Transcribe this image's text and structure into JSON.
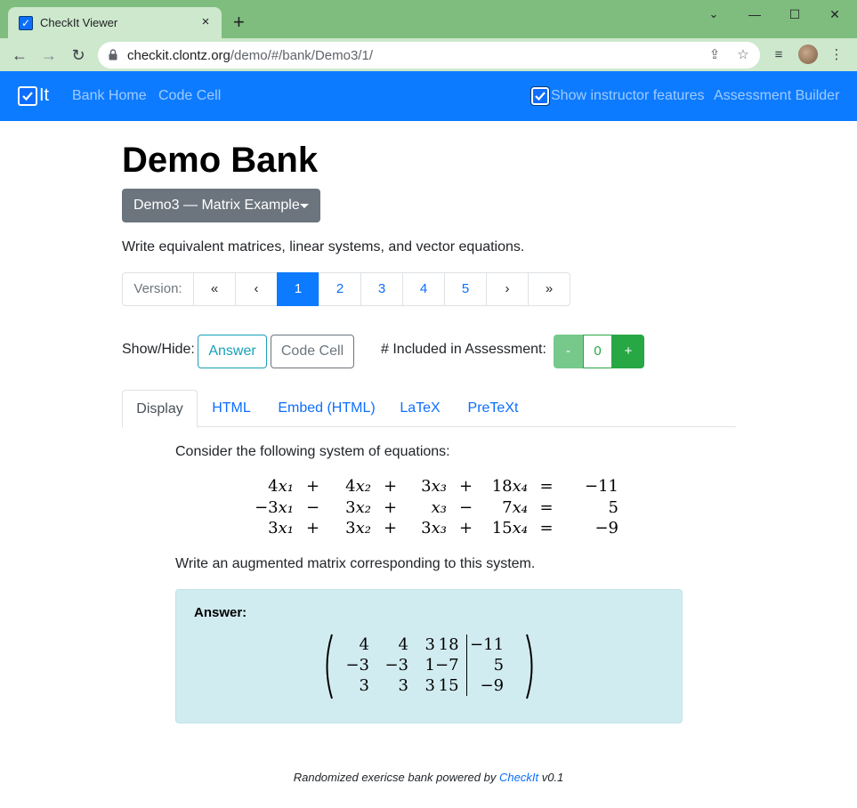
{
  "browser": {
    "tab_title": "CheckIt Viewer",
    "tab_close": "×",
    "new_tab": "+",
    "url_host": "checkit.clontz.org",
    "url_path": "/demo/#/bank/Demo3/1/",
    "window_minimize": "—",
    "window_maximize": "☐",
    "window_close": "✕"
  },
  "navbar": {
    "brand": "It",
    "links": [
      "Bank Home",
      "Code Cell"
    ],
    "instructor_label": "Show instructor features",
    "instructor_checked": true,
    "assessment_builder": "Assessment Builder"
  },
  "page": {
    "title": "Demo Bank",
    "exercise_dropdown": "Demo3 — Matrix Example",
    "description": "Write equivalent matrices, linear systems, and vector equations."
  },
  "pagination": {
    "label": "Version:",
    "first": "«",
    "prev": "‹",
    "versions": [
      "1",
      "2",
      "3",
      "4",
      "5"
    ],
    "active": "1",
    "next": "›",
    "last": "»"
  },
  "controls": {
    "show_hide_label": "Show/Hide:",
    "answer_button": "Answer",
    "code_cell_button": "Code Cell",
    "included_label": "# Included in Assessment:",
    "minus": "-",
    "count": "0",
    "plus": "+"
  },
  "tabs": [
    "Display",
    "HTML",
    "Embed (HTML)",
    "LaTeX",
    "PreTeXt"
  ],
  "active_tab": "Display",
  "exercise": {
    "prompt": "Consider the following system of equations:",
    "system": [
      {
        "t1": "4",
        "op1": "+",
        "t2": "4",
        "op2": "+",
        "t3": "3",
        "op3": "+",
        "t4": "18",
        "rhs": "−11"
      },
      {
        "t1": "−3",
        "op1": "−",
        "t2": "3",
        "op2": "+",
        "t3": "",
        "op3": "−",
        "t4": "7",
        "rhs": "5"
      },
      {
        "t1": "3",
        "op1": "+",
        "t2": "3",
        "op2": "+",
        "t3": "3",
        "op3": "+",
        "t4": "15",
        "rhs": "−9"
      }
    ],
    "instruction": "Write an augmented matrix corresponding to this system.",
    "answer_label": "Answer:",
    "matrix": [
      [
        "4",
        "4",
        "3",
        "18",
        "−11"
      ],
      [
        "−3",
        "−3",
        "1",
        "−7",
        "5"
      ],
      [
        "3",
        "3",
        "3",
        "15",
        "−9"
      ]
    ]
  },
  "footer": {
    "text": "Randomized exericse bank powered by",
    "link": "CheckIt",
    "version": "v0.1"
  },
  "colors": {
    "primary": "#0d7bff",
    "info": "#17a2b8",
    "success": "#28a745",
    "secondary": "#6c757d",
    "answer_bg": "#d1ecf1",
    "chrome_frame": "#7fbd7f",
    "chrome_toolbar": "#cde8cd"
  }
}
